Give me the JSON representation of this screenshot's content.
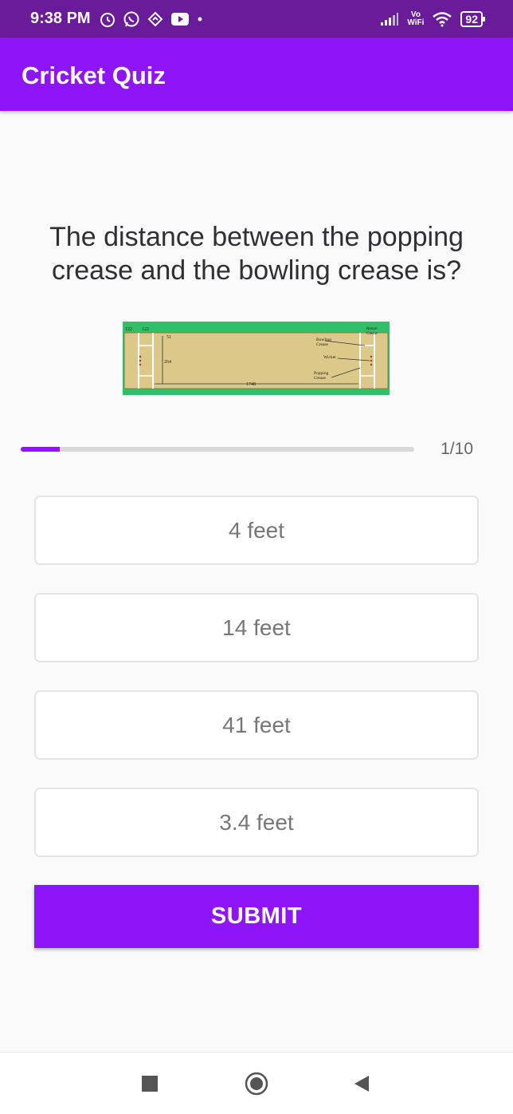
{
  "status_bar": {
    "time": "9:38 PM",
    "network_label": "Vo\nWiFi",
    "battery": "92",
    "icons": [
      "alarm-icon",
      "whatsapp-icon",
      "nav-app-icon",
      "youtube-icon",
      "dot-icon",
      "signal-icon",
      "wifi-icon",
      "battery-icon"
    ]
  },
  "app_bar": {
    "title": "Cricket Quiz"
  },
  "question": {
    "text": "The distance between the popping crease and the bowling crease is?",
    "image_labels": {
      "top_left_a": "122",
      "top_left_b": "122",
      "short": "51",
      "width": "264",
      "length": "1748",
      "bowling_crease": "Bowling\nCrease",
      "wicket": "Wicket",
      "popping_crease": "Popping\nCrease",
      "return_crease": "Return\nCrease"
    }
  },
  "progress": {
    "current": 1,
    "total": 10,
    "label": "1/10",
    "fraction": 0.1
  },
  "options": [
    {
      "label": "4 feet"
    },
    {
      "label": "14 feet"
    },
    {
      "label": "41 feet"
    },
    {
      "label": "3.4 feet"
    }
  ],
  "submit": {
    "label": "SUBMIT"
  },
  "nav_bar": {
    "buttons": [
      "recents-button",
      "home-button",
      "back-button"
    ]
  },
  "colors": {
    "status_bar": "#6a1b9a",
    "primary": "#8e15f7",
    "background": "#fafafa",
    "pitch_green": "#30c06a",
    "pitch_sand": "#dcc989"
  }
}
